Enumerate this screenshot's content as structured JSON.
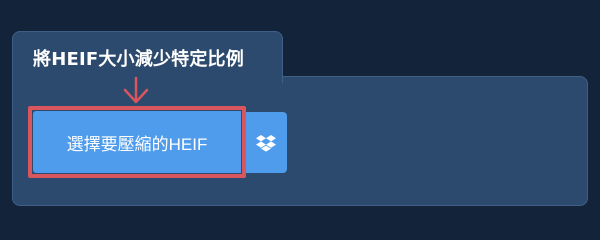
{
  "section": {
    "title": "將HEIF大小減少特定比例"
  },
  "upload": {
    "label": "選擇要壓縮的HEIF"
  },
  "icons": {
    "annotation": "arrow-down-icon",
    "dropbox": "dropbox-icon"
  },
  "colors": {
    "background": "#12233a",
    "panel": "#2c4a6d",
    "button": "#4f9cec",
    "highlight": "#d9565e",
    "text": "#ffffff"
  }
}
